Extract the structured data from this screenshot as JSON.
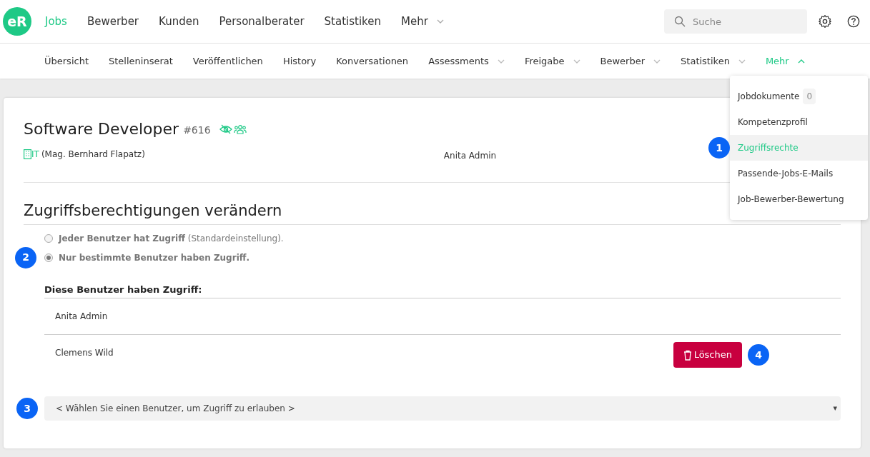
{
  "logo": "eR",
  "main_nav": [
    {
      "label": "Jobs",
      "selected": true,
      "caret": false
    },
    {
      "label": "Bewerber",
      "selected": false,
      "caret": false
    },
    {
      "label": "Kunden",
      "selected": false,
      "caret": false
    },
    {
      "label": "Personalberater",
      "selected": false,
      "caret": false
    },
    {
      "label": "Statistiken",
      "selected": false,
      "caret": false
    },
    {
      "label": "Mehr",
      "selected": false,
      "caret": true
    }
  ],
  "search": {
    "placeholder": "Suche"
  },
  "sub_nav": [
    {
      "label": "Übersicht",
      "selected": false,
      "caret": false
    },
    {
      "label": "Stelleninserat",
      "selected": false,
      "caret": false
    },
    {
      "label": "Veröffentlichen",
      "selected": false,
      "caret": false
    },
    {
      "label": "History",
      "selected": false,
      "caret": false
    },
    {
      "label": "Konversationen",
      "selected": false,
      "caret": false
    },
    {
      "label": "Assessments",
      "selected": false,
      "caret": true,
      "expanded": false
    },
    {
      "label": "Freigabe",
      "selected": false,
      "caret": true,
      "expanded": false
    },
    {
      "label": "Bewerber",
      "selected": false,
      "caret": true,
      "expanded": false
    },
    {
      "label": "Statistiken",
      "selected": false,
      "caret": true,
      "expanded": false
    },
    {
      "label": "Mehr",
      "selected": true,
      "caret": true,
      "expanded": true
    }
  ],
  "more_menu": [
    {
      "label": "Jobdokumente",
      "count": "0",
      "selected": false
    },
    {
      "label": "Kompetenzprofil",
      "selected": false
    },
    {
      "label": "Zugriffsrechte",
      "selected": true,
      "callout": "1"
    },
    {
      "label": "Passende-Jobs-E-Mails",
      "selected": false
    },
    {
      "label": "Job-Bewerber-Bewertung",
      "selected": false
    }
  ],
  "job": {
    "title": "Software Developer",
    "number": "#616",
    "department": "IT",
    "contact": "(Mag. Bernhard Flapatz)",
    "owner": "Anita Admin"
  },
  "section_title": "Zugriffsberechtigungen verändern",
  "access_options": [
    {
      "label": "**Jeder Benutzer hat Zugriff** (Standardeinstellung).",
      "selected": false
    },
    {
      "label": "**Nur bestimmte Benutzer haben Zugriff.**",
      "selected": true,
      "callout": "2"
    }
  ],
  "users_heading": "Diese Benutzer haben Zugriff:",
  "users": [
    {
      "name": "Anita Admin"
    },
    {
      "name": "Clemens Wild",
      "delete_button": "Löschen",
      "callout": "4"
    }
  ],
  "user_select": {
    "value": "< Wählen Sie einen Benutzer, um Zugriff zu erlauben >",
    "arrow": "▾",
    "callout": "3"
  }
}
